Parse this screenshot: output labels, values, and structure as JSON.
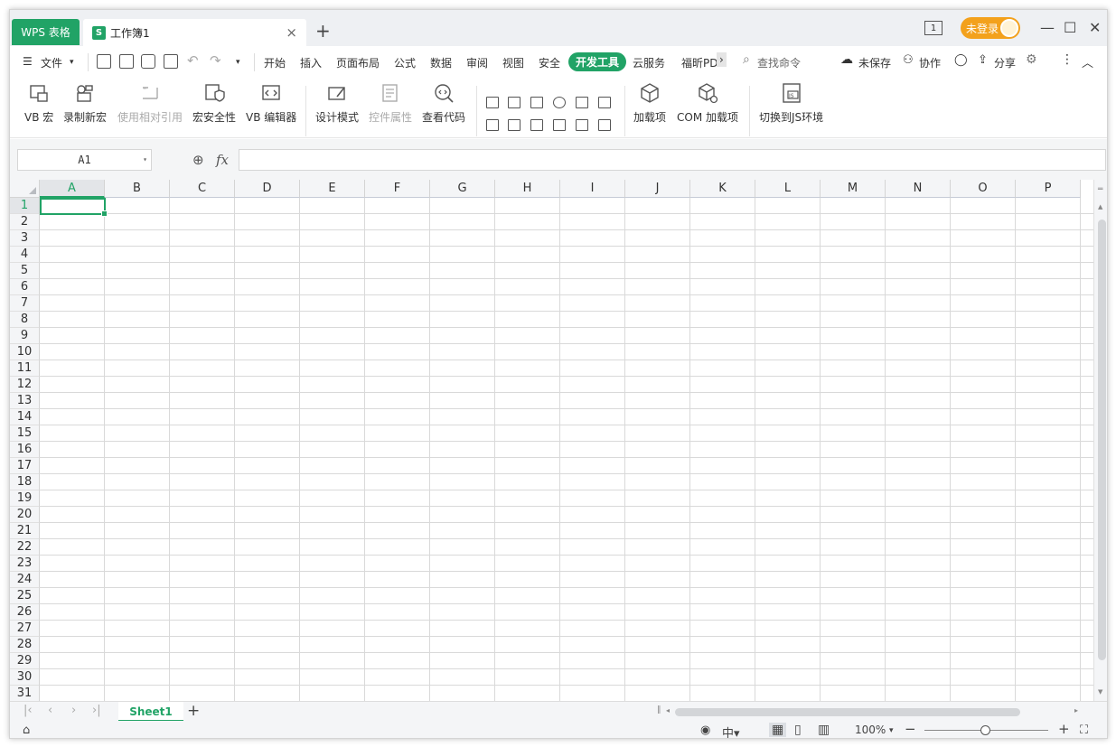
{
  "titlebar": {
    "app_tab": "WPS 表格",
    "doc_icon": "S",
    "doc_title": "工作簿1",
    "login_label": "未登录",
    "page_badge": "1"
  },
  "menu": {
    "file": "文件",
    "tabs": [
      "开始",
      "插入",
      "页面布局",
      "公式",
      "数据",
      "审阅",
      "视图",
      "安全",
      "开发工具",
      "云服务",
      "福昕PD"
    ],
    "search": "查找命令",
    "unsaved": "未保存",
    "collab": "协作",
    "share": "分享"
  },
  "ribbon": {
    "vb_macro": "VB 宏",
    "record_macro": "录制新宏",
    "relative_ref": "使用相对引用",
    "macro_security": "宏安全性",
    "vb_editor": "VB 编辑器",
    "design_mode": "设计模式",
    "control_props": "控件属性",
    "view_code": "查看代码",
    "addins": "加载项",
    "com_addins": "COM 加载项",
    "switch_js": "切换到JS环境"
  },
  "formula": {
    "namebox": "A1",
    "fx": "fx",
    "value": ""
  },
  "grid": {
    "columns": [
      "A",
      "B",
      "C",
      "D",
      "E",
      "F",
      "G",
      "H",
      "I",
      "J",
      "K",
      "L",
      "M",
      "N",
      "O",
      "P"
    ],
    "rows": [
      "1",
      "2",
      "3",
      "4",
      "5",
      "6",
      "7",
      "8",
      "9",
      "10",
      "11",
      "12",
      "13",
      "14",
      "15",
      "16",
      "17",
      "18",
      "19",
      "20",
      "21",
      "22",
      "23",
      "24",
      "25",
      "26",
      "27",
      "28",
      "29",
      "30",
      "31"
    ],
    "active_cell": "A1"
  },
  "sheets": {
    "tabs": [
      "Sheet1"
    ]
  },
  "status": {
    "zoom": "100%",
    "zoom_level": 1.0
  },
  "colors": {
    "accent": "#21a366",
    "login": "#f3a11c"
  }
}
